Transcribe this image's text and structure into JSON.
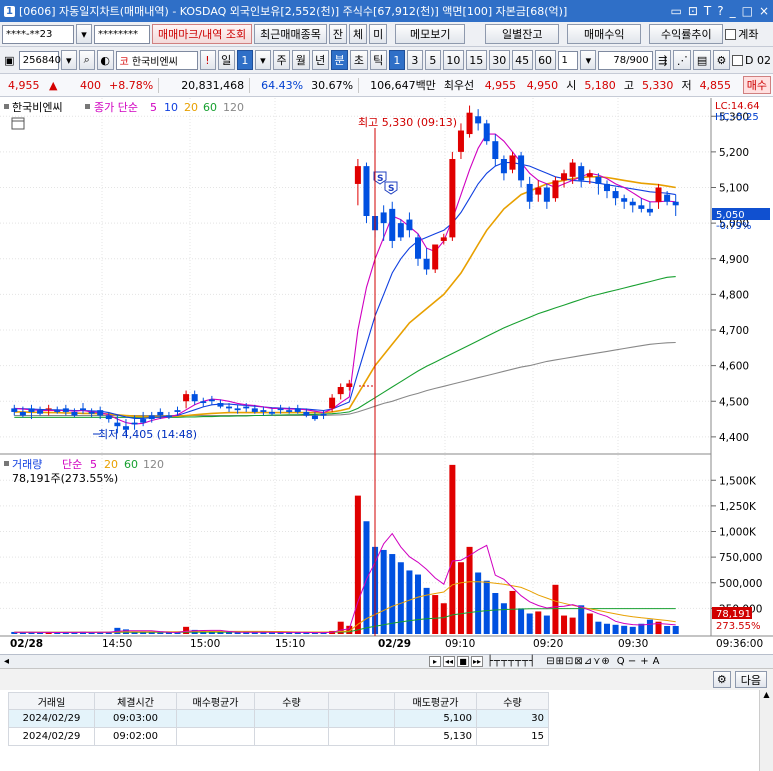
{
  "window": {
    "screen_no": "1",
    "title": "[0606] 자동일지차트(매매내역) - KOSDAQ 외국인보유[2,552(천)] 주식수[67,912(천)] 액면[100] 자본금[68(억)]",
    "controls": [
      "▭",
      "⊡",
      "T",
      "?",
      "_",
      "□",
      "×"
    ]
  },
  "toolbar1": {
    "account_value": "****-**23",
    "password_value": "********",
    "btn_trade_marks": "매매마크/내역 조회",
    "btn_recent_trades": "최근매매종목",
    "btn_balance": "잔",
    "btn_fill": "체",
    "btn_pending": "미",
    "btn_memo": "메모보기",
    "btn_daily_balance": "일별잔고",
    "btn_trade_profit": "매매수익",
    "btn_yield_trend": "수익률추이",
    "chk_account_label": "계좌"
  },
  "toolbar2": {
    "code_value": "256840",
    "name_prefix": "코",
    "stock_name": "한국비엔씨",
    "warn": "!",
    "day_label": "일",
    "day_value": "1",
    "periods": [
      "주",
      "월",
      "년",
      "분",
      "초",
      "틱"
    ],
    "minute_options": [
      "1",
      "3",
      "5",
      "10",
      "15",
      "30",
      "45",
      "60"
    ],
    "custom_minute": "1",
    "count": "78",
    "count_total": "/900"
  },
  "pricebar": {
    "price": "4,955",
    "arrow": "▲",
    "change": "400",
    "change_rate": "+8.78%",
    "volume": "20,831,468",
    "ratio1": "64.43%",
    "ratio2": "30.67%",
    "trade_value": "106,647백만",
    "best_label": "최우선",
    "best_ask": "4,955",
    "best_bid": "4,950",
    "open_label": "시",
    "open": "5,180",
    "high_label": "고",
    "high": "5,330",
    "low_label": "저",
    "low": "4,855",
    "buy_button": "매수"
  },
  "price_panel": {
    "stock_label": "한국비엔씨",
    "ma_label": "종가 단순",
    "ma_periods": [
      "5",
      "10",
      "20",
      "60",
      "120"
    ],
    "ma_colors": [
      "#d000c0",
      "#1040e0",
      "#e8a000",
      "#18a030",
      "#888888"
    ],
    "hi_annotation": "최고 5,330 (09:13)",
    "lo_annotation": "최저 4,405 (14:48)",
    "lc": "LC:14.64",
    "hc": "HC:-5.25",
    "current_price": "5,050",
    "current_change": "-0.79%",
    "y_ticks": [
      "5,300",
      "5,200",
      "5,100",
      "5,000",
      "4,900",
      "4,800",
      "4,700",
      "4,600",
      "4,500",
      "4,400"
    ]
  },
  "volume_panel": {
    "label": "거래량",
    "ma_label": "단순",
    "ma_periods": [
      "5",
      "20",
      "60",
      "120"
    ],
    "current_volume": "78,191주(273.55%)",
    "current_tag": "78,191",
    "current_ratio": "273.55%",
    "y_ticks": [
      "1,500K",
      "1,250K",
      "1,000K",
      "750,000",
      "500,000",
      "250,000"
    ]
  },
  "x_axis": {
    "labels": [
      "02/28",
      "14:50",
      "15:00",
      "15:10",
      "02/29",
      "09:10",
      "09:20",
      "09:30"
    ],
    "current_time": "09:36:00"
  },
  "chart_data": {
    "type": "candlestick",
    "y_range": [
      4380,
      5340
    ],
    "volume_range": [
      0,
      1600000
    ],
    "candles": [
      [
        4480,
        4490,
        4470,
        4460
      ],
      [
        4470,
        4485,
        4460,
        4455
      ],
      [
        4480,
        4490,
        4470,
        4450
      ],
      [
        4475,
        4485,
        4465,
        4460
      ],
      [
        4480,
        4490,
        4480,
        4460
      ],
      [
        4475,
        4485,
        4470,
        4465
      ],
      [
        4480,
        4490,
        4470,
        4460
      ],
      [
        4470,
        4480,
        4460,
        4455
      ],
      [
        4480,
        4495,
        4475,
        4465
      ],
      [
        4470,
        4480,
        4465,
        4455
      ],
      [
        4475,
        4485,
        4460,
        4450
      ],
      [
        4460,
        4470,
        4450,
        4440
      ],
      [
        4440,
        4460,
        4430,
        4410
      ],
      [
        4430,
        4450,
        4420,
        4405
      ],
      [
        4440,
        4460,
        4435,
        4420
      ],
      [
        4450,
        4470,
        4440,
        4430
      ],
      [
        4460,
        4470,
        4450,
        4440
      ],
      [
        4470,
        4480,
        4460,
        4450
      ],
      [
        4460,
        4470,
        4455,
        4450
      ],
      [
        4475,
        4485,
        4470,
        4460
      ],
      [
        4500,
        4530,
        4520,
        4480
      ],
      [
        4520,
        4530,
        4500,
        4490
      ],
      [
        4500,
        4510,
        4495,
        4485
      ],
      [
        4505,
        4515,
        4500,
        4490
      ],
      [
        4495,
        4505,
        4485,
        4480
      ],
      [
        4485,
        4495,
        4480,
        4470
      ],
      [
        4480,
        4490,
        4475,
        4465
      ],
      [
        4485,
        4495,
        4480,
        4470
      ],
      [
        4480,
        4490,
        4470,
        4465
      ],
      [
        4475,
        4485,
        4470,
        4460
      ],
      [
        4470,
        4480,
        4465,
        4460
      ],
      [
        4480,
        4490,
        4475,
        4465
      ],
      [
        4475,
        4485,
        4470,
        4465
      ],
      [
        4480,
        4490,
        4470,
        4465
      ],
      [
        4470,
        4480,
        4460,
        4455
      ],
      [
        4460,
        4470,
        4450,
        4445
      ],
      [
        4465,
        4475,
        4460,
        4450
      ],
      [
        4480,
        4520,
        4510,
        4470
      ],
      [
        4520,
        4550,
        4540,
        4505
      ],
      [
        4540,
        4560,
        4550,
        4530
      ],
      [
        5110,
        5180,
        5160,
        5050
      ],
      [
        5160,
        5170,
        5020,
        5000
      ],
      [
        5020,
        5030,
        4980,
        4960
      ],
      [
        5030,
        5050,
        5000,
        4950
      ],
      [
        5040,
        5060,
        4950,
        4930
      ],
      [
        5000,
        5010,
        4960,
        4950
      ],
      [
        5010,
        5030,
        4980,
        4960
      ],
      [
        4960,
        4970,
        4900,
        4880
      ],
      [
        4900,
        4930,
        4870,
        4855
      ],
      [
        4870,
        4890,
        4940,
        4860
      ],
      [
        4950,
        4970,
        4960,
        4940
      ],
      [
        4960,
        5200,
        5180,
        4950
      ],
      [
        5200,
        5280,
        5260,
        5180
      ],
      [
        5250,
        5330,
        5310,
        5240
      ],
      [
        5300,
        5320,
        5280,
        5260
      ],
      [
        5280,
        5290,
        5230,
        5220
      ],
      [
        5230,
        5250,
        5180,
        5160
      ],
      [
        5180,
        5190,
        5140,
        5120
      ],
      [
        5150,
        5200,
        5190,
        5140
      ],
      [
        5190,
        5200,
        5120,
        5100
      ],
      [
        5110,
        5130,
        5060,
        5040
      ],
      [
        5080,
        5120,
        5100,
        5060
      ],
      [
        5100,
        5110,
        5060,
        5040
      ],
      [
        5070,
        5130,
        5120,
        5060
      ],
      [
        5120,
        5150,
        5140,
        5100
      ],
      [
        5130,
        5180,
        5170,
        5110
      ],
      [
        5160,
        5170,
        5120,
        5100
      ],
      [
        5130,
        5150,
        5140,
        5110
      ],
      [
        5130,
        5140,
        5110,
        5080
      ],
      [
        5110,
        5120,
        5090,
        5070
      ],
      [
        5090,
        5100,
        5070,
        5050
      ],
      [
        5070,
        5080,
        5060,
        5040
      ],
      [
        5060,
        5070,
        5050,
        5030
      ],
      [
        5050,
        5070,
        5040,
        5030
      ],
      [
        5040,
        5060,
        5030,
        5020
      ],
      [
        5060,
        5110,
        5100,
        5040
      ],
      [
        5080,
        5090,
        5060,
        5050
      ],
      [
        5060,
        5080,
        5050,
        5020
      ]
    ],
    "volumes": [
      20000,
      18000,
      15000,
      14000,
      16000,
      12000,
      18000,
      15000,
      22000,
      14000,
      16000,
      18000,
      60000,
      45000,
      20000,
      18000,
      15000,
      14000,
      16000,
      18000,
      70000,
      40000,
      25000,
      22000,
      18000,
      16000,
      15000,
      18000,
      20000,
      15000,
      14000,
      18000,
      15000,
      16000,
      14000,
      12000,
      15000,
      30000,
      120000,
      80000,
      1350000,
      1100000,
      850000,
      820000,
      780000,
      700000,
      620000,
      580000,
      450000,
      380000,
      300000,
      1650000,
      700000,
      850000,
      600000,
      520000,
      400000,
      300000,
      420000,
      250000,
      200000,
      220000,
      180000,
      480000,
      180000,
      160000,
      280000,
      200000,
      120000,
      100000,
      90000,
      80000,
      70000,
      100000,
      140000,
      120000,
      78191,
      78191
    ],
    "ma_lines": {
      "ma5": [
        4480,
        4478,
        4476,
        4474,
        4474,
        4474,
        4474,
        4472,
        4474,
        4470,
        4468,
        4462,
        4450,
        4440,
        4436,
        4438,
        4446,
        4452,
        4456,
        4462,
        4476,
        4490,
        4500,
        4506,
        4504,
        4500,
        4494,
        4490,
        4488,
        4484,
        4480,
        4480,
        4478,
        4478,
        4476,
        4472,
        4468,
        4478,
        4496,
        4512,
        4700,
        4820,
        4900,
        4960,
        5020,
        5010,
        4990,
        4970,
        4930,
        4920,
        4950,
        5010,
        5080,
        5150,
        5210,
        5250,
        5250,
        5230,
        5200,
        5170,
        5140,
        5120,
        5110,
        5100,
        5110,
        5120,
        5130,
        5140,
        5135,
        5125,
        5110,
        5100,
        5085,
        5070,
        5060,
        5060,
        5062,
        5060
      ],
      "ma10": [
        4480,
        4479,
        4478,
        4477,
        4476,
        4476,
        4475,
        4474,
        4474,
        4473,
        4472,
        4468,
        4462,
        4456,
        4452,
        4452,
        4454,
        4456,
        4458,
        4460,
        4468,
        4476,
        4484,
        4490,
        4492,
        4492,
        4490,
        4488,
        4486,
        4484,
        4482,
        4481,
        4480,
        4479,
        4478,
        4476,
        4474,
        4478,
        4488,
        4498,
        4580,
        4660,
        4740,
        4800,
        4860,
        4900,
        4930,
        4950,
        4960,
        4970,
        4980,
        5000,
        5030,
        5070,
        5110,
        5140,
        5160,
        5170,
        5170,
        5165,
        5160,
        5150,
        5140,
        5130,
        5125,
        5120,
        5118,
        5116,
        5112,
        5108,
        5104,
        5100,
        5096,
        5092,
        5088,
        5086,
        5084,
        5080
      ],
      "ma20": [
        4470,
        4470,
        4469,
        4469,
        4468,
        4468,
        4467,
        4467,
        4466,
        4466,
        4465,
        4464,
        4462,
        4460,
        4458,
        4457,
        4457,
        4457,
        4458,
        4458,
        4460,
        4462,
        4464,
        4466,
        4467,
        4468,
        4468,
        4468,
        4468,
        4468,
        4468,
        4468,
        4468,
        4468,
        4468,
        4468,
        4468,
        4470,
        4474,
        4480,
        4520,
        4560,
        4600,
        4630,
        4660,
        4690,
        4720,
        4740,
        4760,
        4780,
        4800,
        4830,
        4860,
        4900,
        4940,
        4980,
        5010,
        5040,
        5060,
        5080,
        5090,
        5100,
        5110,
        5115,
        5120,
        5125,
        5128,
        5130,
        5130,
        5128,
        5124,
        5120,
        5116,
        5112,
        5110,
        5108,
        5104,
        5100
      ],
      "ma60": [
        4455,
        4455,
        4455,
        4455,
        4455,
        4455,
        4455,
        4455,
        4455,
        4455,
        4455,
        4455,
        4455,
        4455,
        4455,
        4455,
        4455,
        4455,
        4455,
        4455,
        4456,
        4456,
        4457,
        4457,
        4458,
        4458,
        4459,
        4459,
        4460,
        4460,
        4461,
        4461,
        4462,
        4462,
        4463,
        4463,
        4464,
        4465,
        4467,
        4470,
        4480,
        4495,
        4510,
        4525,
        4540,
        4555,
        4570,
        4585,
        4598,
        4610,
        4622,
        4634,
        4646,
        4658,
        4670,
        4682,
        4694,
        4706,
        4716,
        4726,
        4736,
        4746,
        4754,
        4762,
        4770,
        4778,
        4786,
        4794,
        4800,
        4806,
        4812,
        4818,
        4824,
        4830,
        4836,
        4842,
        4848,
        4850
      ],
      "ma120": [
        4460,
        4460,
        4460,
        4460,
        4460,
        4460,
        4460,
        4460,
        4460,
        4460,
        4460,
        4460,
        4460,
        4460,
        4460,
        4460,
        4460,
        4460,
        4460,
        4460,
        4460,
        4460,
        4460,
        4460,
        4460,
        4460,
        4460,
        4460,
        4460,
        4460,
        4460,
        4460,
        4460,
        4460,
        4460,
        4460,
        4460,
        4461,
        4462,
        4464,
        4470,
        4478,
        4486,
        4494,
        4500,
        4508,
        4516,
        4522,
        4530,
        4536,
        4542,
        4548,
        4554,
        4560,
        4566,
        4572,
        4578,
        4584,
        4590,
        4596,
        4600,
        4606,
        4612,
        4616,
        4620,
        4624,
        4628,
        4632,
        4636,
        4640,
        4644,
        4648,
        4652,
        4656,
        4660,
        4662,
        4664,
        4665
      ]
    },
    "vol_ma": {
      "ma5": [
        17000,
        17000,
        17000,
        16000,
        16000,
        15000,
        16000,
        16000,
        17000,
        16000,
        17000,
        17000,
        26000,
        31000,
        32000,
        32000,
        32000,
        23000,
        17000,
        16000,
        27000,
        32000,
        34000,
        35000,
        35000,
        24000,
        19000,
        18000,
        17000,
        17000,
        17000,
        16000,
        16000,
        16000,
        16000,
        14000,
        14000,
        17000,
        38000,
        51000,
        315000,
        534000,
        700000,
        880000,
        980000,
        850000,
        754000,
        700000,
        630000,
        546000,
        486000,
        712000,
        720000,
        766000,
        820000,
        864000,
        574000,
        534000,
        454000,
        374000,
        314000,
        278000,
        254000,
        266000,
        270000,
        286000,
        262000,
        232000,
        198000,
        172000,
        124000,
        102000,
        92000,
        88000,
        96000,
        102000,
        97000,
        89000
      ],
      "ma20": [
        18000,
        18000,
        18000,
        18000,
        18000,
        18000,
        18000,
        18000,
        18000,
        18000,
        18000,
        18000,
        20000,
        22000,
        22000,
        22000,
        22000,
        22000,
        22000,
        22000,
        24000,
        25000,
        25000,
        25000,
        25000,
        25000,
        25000,
        25000,
        25000,
        25000,
        24000,
        24000,
        22000,
        20000,
        20000,
        20000,
        20000,
        20000,
        25000,
        28000,
        95000,
        150000,
        190000,
        230000,
        270000,
        300000,
        330000,
        360000,
        380000,
        395000,
        410000,
        480000,
        500000,
        510000,
        510000,
        505000,
        495000,
        485000,
        470000,
        455000,
        420000,
        380000,
        350000,
        320000,
        300000,
        280000,
        262000,
        245000,
        230000,
        212000,
        196000,
        180000,
        168000,
        158000,
        150000,
        140000,
        132000,
        120000
      ],
      "ma60": [
        18000,
        18000,
        18000,
        18000,
        18000,
        18000,
        18000,
        18000,
        18000,
        18000,
        18000,
        18000,
        18000,
        18000,
        18000,
        18000,
        18000,
        18000,
        18000,
        18000,
        19000,
        19000,
        19000,
        19000,
        19000,
        19000,
        19000,
        19000,
        19000,
        19000,
        19000,
        19000,
        19000,
        19000,
        19000,
        19000,
        19000,
        19000,
        20000,
        21000,
        40000,
        60000,
        75000,
        90000,
        105000,
        118000,
        130000,
        140000,
        148000,
        154000,
        160000,
        186000,
        198000,
        210000,
        220000,
        228000,
        234000,
        238000,
        242000,
        244000,
        246000,
        246000,
        246000,
        248000,
        248000,
        248000,
        248000,
        248000,
        248000,
        248000,
        248000,
        248000,
        248000,
        248000,
        248000,
        248000,
        248000,
        248000
      ]
    }
  },
  "bottom": {
    "next_button": "다음"
  },
  "trade_table": {
    "headers": [
      "거래일",
      "체결시간",
      "매수평균가",
      "수량",
      "",
      "매도평균가",
      "수량"
    ],
    "rows": [
      [
        "2024/02/29",
        "09:03:00",
        "",
        "",
        "",
        "5,100",
        "30"
      ],
      [
        "2024/02/29",
        "09:02:00",
        "",
        "",
        "",
        "5,130",
        "15"
      ]
    ]
  }
}
